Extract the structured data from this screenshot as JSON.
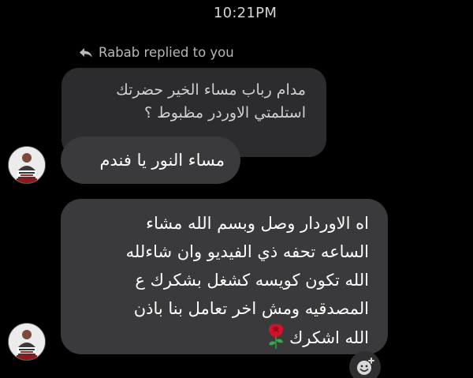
{
  "status_bar": {
    "time": "10:21PM"
  },
  "reply_context": {
    "label": "Rabab replied to you",
    "icon": "reply-arrow-icon",
    "quoted_lines": [
      "مدام رباب مساء الخير حضرتك",
      "استلمتي الاوردر مظبوط ؟"
    ]
  },
  "messages": [
    {
      "lines": [
        "مساء النور يا فندم"
      ],
      "avatar": "sender-avatar"
    },
    {
      "lines": [
        "اه  الاوردار وصل وبسم الله مشاء",
        "الساعه تحفه ذي الفيديو وان شاءلله",
        "الله تكون كويسه كشغل بشكرك ع",
        "المصدقيه ومش اخر تعامل بنا باذن",
        "الله اشكرك"
      ],
      "trailing_emoji": "rose-icon",
      "avatar": "sender-avatar"
    }
  ],
  "react_button": {
    "icon": "add-reaction-icon"
  },
  "colors": {
    "background": "#000000",
    "bubble": "#3a3a3c",
    "quoted_bubble": "#2c2c2e",
    "text": "#ffffff",
    "muted_text": "#b8b8b8"
  }
}
